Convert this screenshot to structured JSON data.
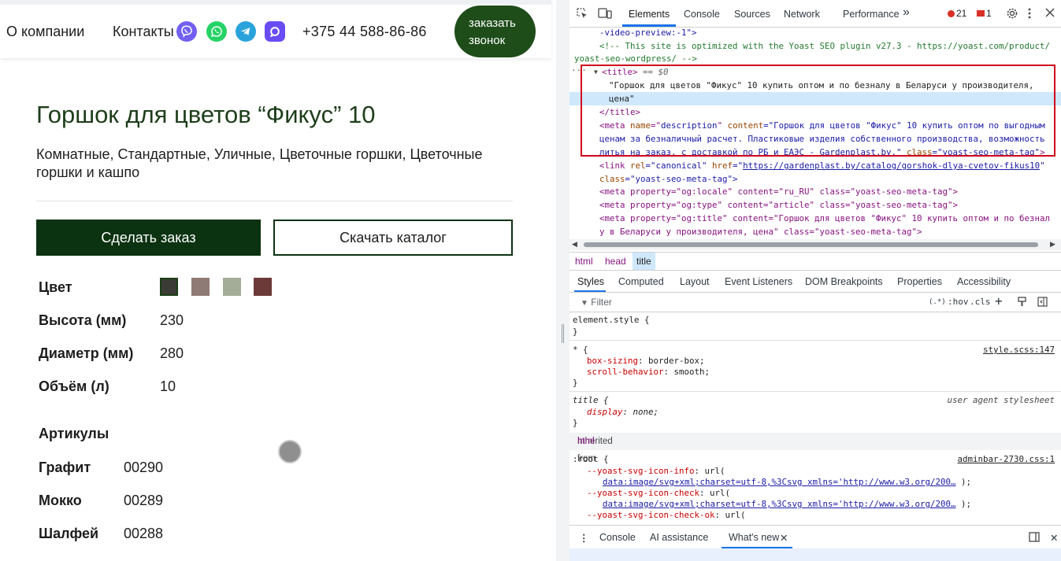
{
  "site": {
    "nav": {
      "about": "О компании",
      "contacts": "Контакты"
    },
    "messengers": [
      {
        "icon": "viber-icon",
        "color": "#7360f2"
      },
      {
        "icon": "whatsapp-icon",
        "color": "#25d366"
      },
      {
        "icon": "telegram-icon",
        "color": "#2aa3db"
      },
      {
        "icon": "max-messenger-icon",
        "color": "#6a4cf5"
      }
    ],
    "phone": "+375 44 588-86-86",
    "callback_line1": "заказать",
    "callback_line2": "звонок"
  },
  "product": {
    "title": "Горшок для цветов “Фикус” 10",
    "categories": "Комнатные, Стандартные, Уличные, Цветочные горшки, Цветочные горшки и кашпо",
    "order_button": "Сделать заказ",
    "catalog_button": "Скачать каталог",
    "color_label": "Цвет",
    "swatches": [
      "#3b3b36",
      "#8f7b75",
      "#a3ad98",
      "#6b3a39"
    ],
    "specs": [
      {
        "label": "Высота (мм)",
        "value": "230"
      },
      {
        "label": "Диаметр (мм)",
        "value": "280"
      },
      {
        "label": "Объём (л)",
        "value": "10"
      }
    ],
    "articles_title": "Артикулы",
    "articles": [
      {
        "name": "Графит",
        "code": "00290"
      },
      {
        "name": "Мокко",
        "code": "00289"
      },
      {
        "name": "Шалфей",
        "code": "00288"
      }
    ]
  },
  "devtools": {
    "tabs": [
      "Elements",
      "Console",
      "Sources",
      "Network",
      "Performance"
    ],
    "more": "»",
    "errors": "21",
    "warnings": "1",
    "code": {
      "l1": "-video-preview:-1\">",
      "l2": "<!-- This site is optimized with the Yoast SEO plugin v27.3 - https://yoast.com/product/",
      "l3": "yoast-seo-wordpress/ -->",
      "title_open": "<title>",
      "selected_marker": "== $0",
      "title_text_1": "\"Горшок для цветов \"Фикус\" 10 купить оптом и по безналу в Беларуси у производителя,",
      "title_text_2": "цена\"",
      "title_close": "</title>",
      "meta_desc_1a": "<meta ",
      "meta_desc_1b": "name",
      "meta_desc_1c": "=\"",
      "meta_desc_1d": "description",
      "meta_desc_1e": "\" ",
      "meta_desc_1f": "content",
      "meta_desc_1g": "=\"Горшок для цветов \"Фикус\" 10 купить оптом по выгодным",
      "meta_desc_2": "ценам за безналичный расчет. Пластиковые изделия собственного производства, возможность",
      "meta_desc_3a": "литья на заказ, с доставкой по РБ и ЕАЭС - Gardenplast.by.\"",
      "meta_desc_3b": " class",
      "meta_desc_3c": "=\"yoast-seo-meta-tag\"",
      "meta_desc_3d": ">",
      "link_1a": "<link ",
      "link_1b": "rel",
      "link_1c": "=\"canonical\" ",
      "link_1d": "href",
      "link_1e": "=\"",
      "link_1f": "https://gardenplast.by/catalog/gorshok-dlya-cvetov-fikus10",
      "link_1g": "\"",
      "link_2a": "class",
      "link_2b": "=\"yoast-seo-meta-tag\">",
      "og_locale": "<meta property=\"og:locale\" content=\"ru_RU\" class=\"yoast-seo-meta-tag\">",
      "og_type": "<meta property=\"og:type\" content=\"article\" class=\"yoast-seo-meta-tag\">",
      "og_title_1": "<meta property=\"og:title\" content=\"Горшок для цветов \"Фикус\" 10 купить оптом и по безнал",
      "og_title_2": "у в Беларуси у производителя, цена\" class=\"yoast-seo-meta-tag\">"
    },
    "breadcrumbs": [
      "html",
      "head",
      "title"
    ],
    "style_tabs": [
      "Styles",
      "Computed",
      "Layout",
      "Event Listeners",
      "DOM Breakpoints",
      "Properties",
      "Accessibility"
    ],
    "filter_placeholder": "Filter",
    "filter_hov": ":hov",
    "filter_cls": ".cls",
    "filter_regex": "(.*)",
    "rules": {
      "element_style_open": "element.style {",
      "close": "}",
      "universal_sel": "* {",
      "universal_src": "style.scss:147",
      "box_sizing_prop": "box-sizing",
      "box_sizing_val": "border-box;",
      "scroll_prop": "scroll-behavior",
      "scroll_val": "smooth;",
      "title_sel": "title {",
      "title_src": "user agent stylesheet",
      "display_prop": "display",
      "display_val": "none;",
      "inherited_label": "Inherited from ",
      "inherited_tag": "html",
      "root_sel": ":root {",
      "root_src": "adminbar-2730.css:1",
      "info_prop": "--yoast-svg-icon-info",
      "check_prop": "--yoast-svg-icon-check",
      "checkok_prop": "--yoast-svg-icon-check-ok",
      "url_open": "url(",
      "data_url": "data:image/svg+xml;charset=utf-8,%3Csvg xmlns='http://www.w3.org/200…",
      "url_close": ");"
    },
    "drawer_tabs": [
      "Console",
      "AI assistance",
      "What's new"
    ]
  }
}
